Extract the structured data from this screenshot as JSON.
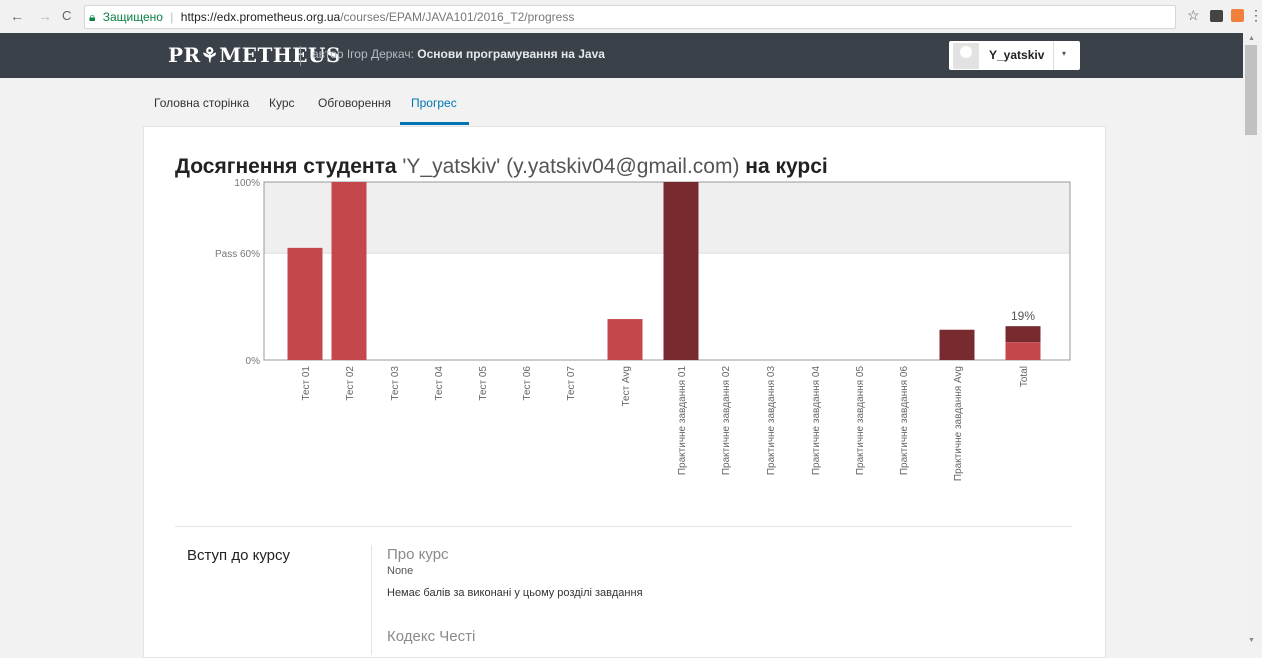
{
  "browser": {
    "back_icon": "←",
    "forward_icon": "→",
    "reload_icon": "C",
    "secure_label": "Защищено",
    "url_host": "https://edx.prometheus.org.ua",
    "url_path": "/courses/EPAM/JAVA101/2016_T2/progress"
  },
  "header": {
    "logo": "PR⚘METHEUS",
    "course_prefix": "автор Ігор Деркач:",
    "course_name": "Основи програмування на Java",
    "username": "Y_yatskiv",
    "caret": "▾"
  },
  "tabs": [
    {
      "label": "Головна сторінка"
    },
    {
      "label": "Курс"
    },
    {
      "label": "Обговорення"
    },
    {
      "label": "Прогрес"
    }
  ],
  "page": {
    "title_prefix": "Досягнення студента",
    "title_student": "'Y_yatskiv' (y.yatskiv04@gmail.com)",
    "title_suffix": "на курсі"
  },
  "chart_data": {
    "type": "bar",
    "y_ticks": [
      "100%",
      "Pass 60%",
      "0%"
    ],
    "ylim": [
      0,
      100
    ],
    "pass_threshold": 60,
    "categories": [
      "Тест 01",
      "Тест 02",
      "Тест 03",
      "Тест 04",
      "Тест 05",
      "Тест 06",
      "Тест 07",
      "Тест Avg",
      "Практичне завдання 01",
      "Практичне завдання 02",
      "Практичне завдання 03",
      "Практичне завдання 04",
      "Практичне завдання 05",
      "Практичне завдання 06",
      "Практичне завдання Avg",
      "Total"
    ],
    "values": [
      63,
      100,
      0,
      0,
      0,
      0,
      0,
      23,
      100,
      0,
      0,
      0,
      0,
      0,
      17,
      19
    ],
    "total_breakdown": {
      "tests": 10,
      "practical": 9
    },
    "total_label": "19%",
    "colors": {
      "test": "#c4474c",
      "practical": "#772b2f",
      "pass_band": "#efefef",
      "frame": "#999999"
    }
  },
  "sections": [
    {
      "name": "Вступ до курсу",
      "subsections": [
        {
          "title": "Про курс",
          "date": "None",
          "message": "Немає балів за виконані у цьому розділі завдання"
        },
        {
          "title": "Кодекс Честі"
        }
      ]
    }
  ]
}
